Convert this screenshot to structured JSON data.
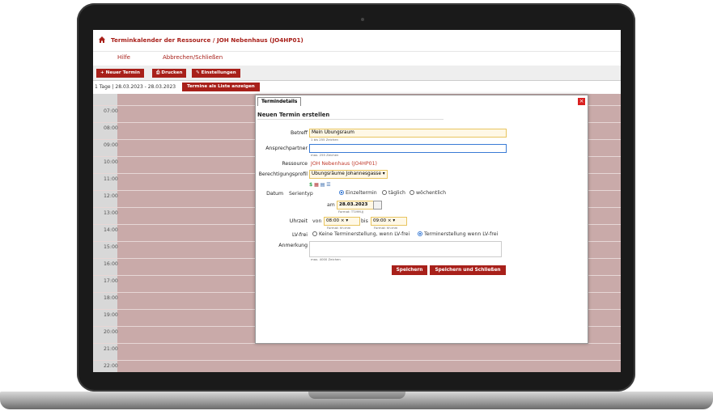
{
  "app": {
    "title": "Terminkalender der Ressource  / JOH Nebenhaus (JO4HP01)",
    "menu": [
      "Hilfe",
      "Abbrechen/Schließen"
    ]
  },
  "toolbar": {
    "new_label": "+ Neuer Termin",
    "print_label": "⎙ Drucken",
    "settings_label": "✎ Einstellungen"
  },
  "range": {
    "label": "1 Tage | 28.03.2023 - 28.03.2023",
    "list_button": "Termine als Liste anzeigen"
  },
  "calendar": {
    "hours": [
      "07:00",
      "08:00",
      "09:00",
      "10:00",
      "11:00",
      "12:00",
      "13:00",
      "14:00",
      "15:00",
      "16:00",
      "17:00",
      "18:00",
      "19:00",
      "20:00",
      "21:00",
      "22:00"
    ]
  },
  "modal": {
    "tab": "Termindetails",
    "close_label": "×",
    "heading": "Neuen Termin erstellen",
    "betreff_label": "Betreff",
    "betreff_value": "Mein Übungsraum",
    "betreff_hint": "1 bis 255 Zeichen",
    "ansprech_label": "Ansprechpartner",
    "ansprech_hint": "max. 255 Zeichen",
    "ressource_label": "Ressource",
    "ressource_value": "JOH Nebenhaus (JO4HP01)",
    "berecht_label": "Berechtigungsprofil",
    "berecht_value": "Übungsräume Johannesgasse ▾",
    "datum_label": "Datum",
    "serientyp_label": "Serientyp",
    "serie_opts": [
      "Einzeltermin",
      "täglich",
      "wöchentlich"
    ],
    "am_label": "am",
    "date_value": "28.03.2023",
    "date_hint": "Format: TT.MM.JJ",
    "uhrzeit_label": "Uhrzeit",
    "von_label": "von",
    "von_value": "08:00",
    "bis_label": "bis",
    "bis_value": "09:00",
    "time_hint": "Format: hh:mm",
    "lvfrei_label": "LV-frei",
    "lvfrei_opts": [
      "Keine Terminerstellung, wenn LV-frei",
      "Terminerstellung wenn LV-frei"
    ],
    "anmerkung_label": "Anmerkung",
    "anmerkung_hint": "max. 4000 Zeichen",
    "save_label": "Speichern",
    "save_close_label": "Speichern und Schließen"
  },
  "colors": {
    "accent": "#a8201a",
    "calendar_bg": "#c9aaa9"
  }
}
